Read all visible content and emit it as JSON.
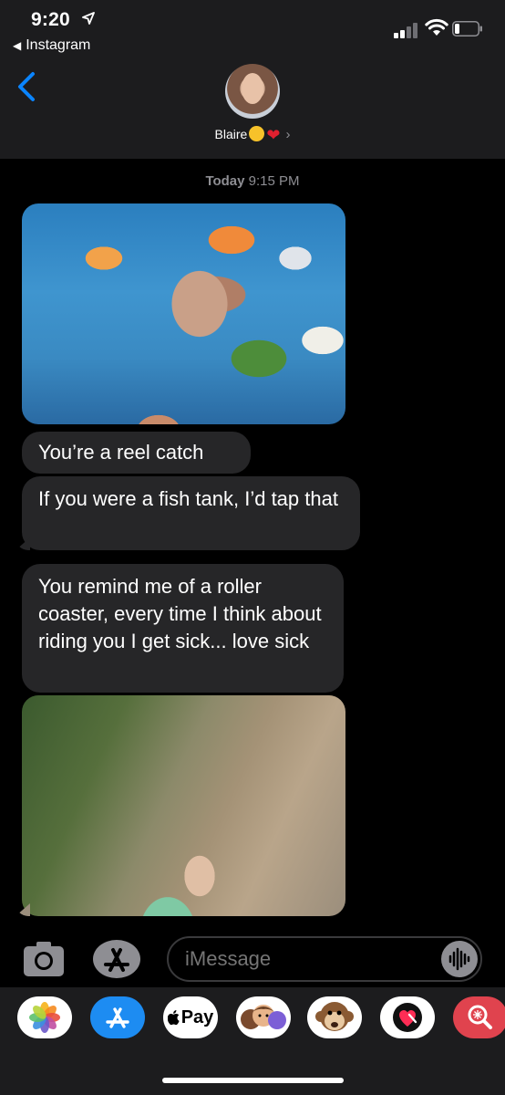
{
  "status_bar": {
    "time": "9:20",
    "back_app": "Instagram"
  },
  "contact": {
    "name": "Blaire",
    "name_emojis": [
      "smiling-face-with-heart-eyes",
      "red-heart"
    ]
  },
  "conversation": {
    "timestamp_day": "Today",
    "timestamp_time": "9:15 PM",
    "messages": [
      {
        "type": "image",
        "depicts": "woman's face superimposed on aquarium of tropical fish"
      },
      {
        "type": "text",
        "text": "You’re a reel catch"
      },
      {
        "type": "text",
        "text": "If you were a fish tank, I’d tap that"
      },
      {
        "type": "text",
        "text": "You remind me of a roller coaster, every time I think about riding you I get sick... love sick"
      },
      {
        "type": "image",
        "depicts": "woman with raised arms on a wooden roller coaster track"
      }
    ]
  },
  "input_bar": {
    "placeholder": "iMessage"
  },
  "app_drawer": {
    "items": [
      {
        "name": "photos-app",
        "label": ""
      },
      {
        "name": "app-store",
        "label": ""
      },
      {
        "name": "apple-pay",
        "label": "Pay"
      },
      {
        "name": "memoji",
        "label": ""
      },
      {
        "name": "animoji-monkey",
        "label": ""
      },
      {
        "name": "digital-touch",
        "label": ""
      },
      {
        "name": "image-search",
        "label": ""
      }
    ]
  },
  "colors": {
    "header_bg": "#1c1c1e",
    "bubble_bg": "#262628",
    "ios_blue": "#0a84ff",
    "secondary_text": "#8e8e93"
  }
}
